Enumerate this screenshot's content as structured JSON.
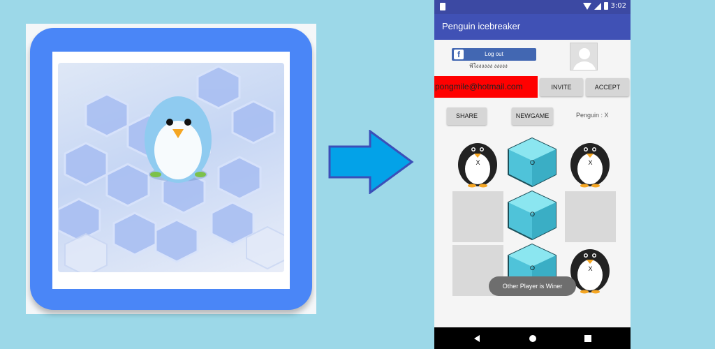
{
  "phone": {
    "status_time": "3:02",
    "app_title": "Penguin icebreaker",
    "facebook": {
      "button_label": "Log out",
      "user_name": "ฟ้ใงงงงงง งงงงง"
    },
    "email": "pongmile@hotmail.com",
    "buttons": {
      "invite": "INVITE",
      "accept": "ACCEPT",
      "share": "SHARE",
      "newgame": "NEWGAME"
    },
    "turn_label": "Penguin : X",
    "board": [
      {
        "type": "penguin",
        "mark": "X"
      },
      {
        "type": "ice",
        "mark": "O"
      },
      {
        "type": "penguin",
        "mark": "X"
      },
      {
        "type": "empty",
        "mark": ""
      },
      {
        "type": "ice",
        "mark": "O"
      },
      {
        "type": "empty",
        "mark": ""
      },
      {
        "type": "empty",
        "mark": ""
      },
      {
        "type": "ice",
        "mark": "O"
      },
      {
        "type": "penguin",
        "mark": "X"
      }
    ],
    "toast": "Other Player is Winer"
  },
  "colors": {
    "background": "#9cd8e8",
    "appbar": "#4051b5",
    "icon_frame": "#4a86f7",
    "email_bg": "#ff0000",
    "arrow": "#03a2e8"
  },
  "icons": [
    "app-icon-penguin",
    "arrow-right-icon",
    "facebook-icon",
    "avatar-placeholder-icon",
    "back-icon",
    "home-icon",
    "recent-apps-icon"
  ]
}
